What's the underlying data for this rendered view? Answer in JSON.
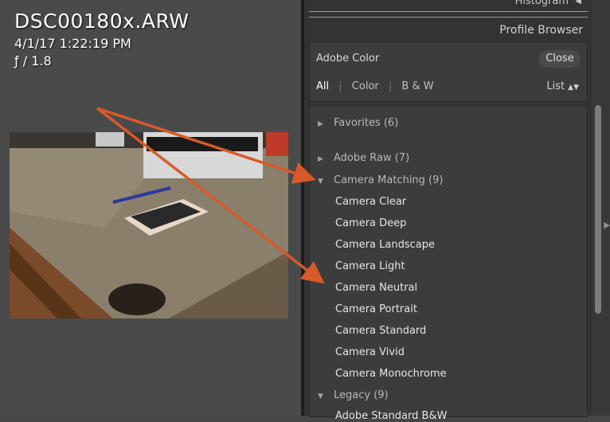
{
  "photo": {
    "file_name": "DSC00180x.ARW",
    "date_time": "4/1/17 1:22:19 PM",
    "aperture": "ƒ / 1.8"
  },
  "panel": {
    "histogram_label": "Histogram",
    "title": "Profile Browser",
    "current_profile": "Adobe Color",
    "close_label": "Close",
    "filters": [
      "All",
      "Color",
      "B & W"
    ],
    "view_label": "List"
  },
  "groups": [
    {
      "label": "Favorites (6)",
      "expanded": false
    },
    {
      "label": "Adobe Raw (7)",
      "expanded": false
    },
    {
      "label": "Camera Matching (9)",
      "expanded": true
    },
    {
      "label": "Legacy (9)",
      "expanded": true
    }
  ],
  "camera_matching_profiles": [
    "Camera Clear",
    "Camera Deep",
    "Camera Landscape",
    "Camera Light",
    "Camera Neutral",
    "Camera Portrait",
    "Camera Standard",
    "Camera Vivid",
    "Camera Monochrome"
  ],
  "legacy_profiles": [
    "Adobe Standard B&W"
  ],
  "colors": {
    "arrow": "#d85a2a",
    "panel_bg": "#3c3c3c",
    "text_primary": "#e6e6e6"
  }
}
